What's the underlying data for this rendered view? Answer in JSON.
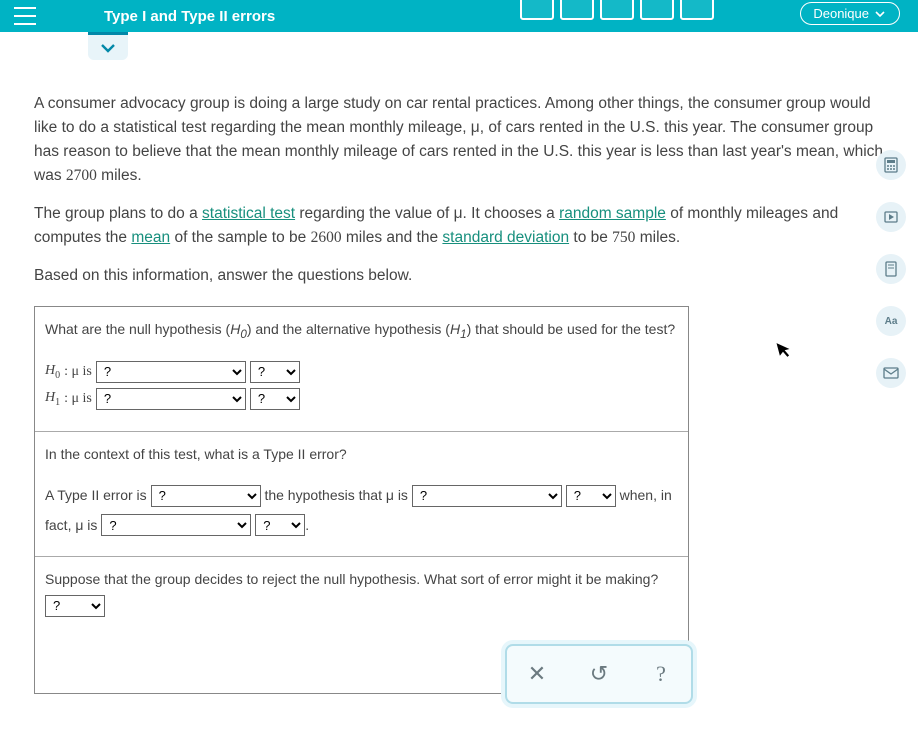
{
  "header": {
    "title": "Type I and Type II errors",
    "user": "Deonique"
  },
  "passage": {
    "p1a": "A consumer advocacy group is doing a large study on car rental practices. Among other things, the consumer group would like to do a statistical test regarding the mean monthly mileage, μ, of cars rented in the U.S. this year. The consumer group has reason to believe that the mean monthly mileage of cars rented in the U.S. this year is less than last year's mean, which was ",
    "val_lastyear": "2700",
    "p1b": " miles.",
    "p2a": "The group plans to do a ",
    "link_stat": "statistical test",
    "p2b": " regarding the value of μ. It chooses a ",
    "link_random": "random sample",
    "p2c": " of monthly mileages and computes the ",
    "link_mean": "mean",
    "p2d": " of the sample to be ",
    "val_mean": "2600",
    "p2e": " miles and the ",
    "link_sd": "standard deviation",
    "p2f": " to be ",
    "val_sd": "750",
    "p2g": " miles.",
    "p3": "Based on this information, answer the questions below."
  },
  "q1": {
    "prompt_a": "What are the null hypothesis (",
    "h0sym": "H",
    "sub0": "0",
    "prompt_b": ") and the alternative hypothesis (",
    "h1sym": "H",
    "sub1": "1",
    "prompt_c": ") that should be used for the test?",
    "line0_pre": ": μ is ",
    "line1_pre": ": μ is ",
    "opt_q": "?"
  },
  "q2": {
    "prompt": "In the context of this test, what is a Type II error?",
    "t1": "A Type II error is ",
    "t2": " the hypothesis that μ is ",
    "t3": " ",
    "t4": " when, in fact, μ is ",
    "t5": " ",
    "t6": "."
  },
  "q3": {
    "prompt": "Suppose that the group decides to reject the null hypothesis. What sort of error might it be making?"
  },
  "selectdefault": "?",
  "buttons": {
    "close": "✕",
    "undo": "↺",
    "help": "?"
  },
  "rail": {
    "calc": "calc",
    "play": "play",
    "book": "book",
    "font": "Aa",
    "mail": "mail"
  }
}
